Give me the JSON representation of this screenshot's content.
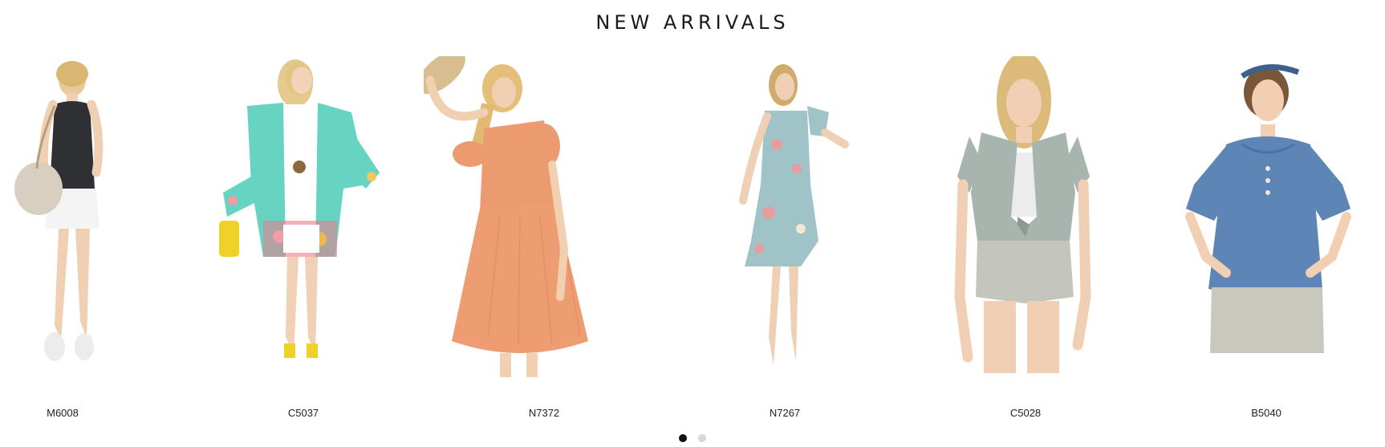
{
  "section": {
    "title": "NEW ARRIVALS"
  },
  "products": [
    {
      "code": "M6008",
      "image_alt": "Woman in black ribbed tank top with white denim mini skirt and white sneakers, carrying a woven bag"
    },
    {
      "code": "C5037",
      "image_alt": "Woman in aqua floral-print kimono over white top and white shorts with yellow sandals and yellow handbag"
    },
    {
      "code": "N7372",
      "image_alt": "Woman in peach puff-sleeve button-front dress holding a straw hat"
    },
    {
      "code": "N7267",
      "image_alt": "Woman in light blue floral flutter-sleeve midi dress with strappy heels"
    },
    {
      "code": "C5028",
      "image_alt": "Woman in sage floral tie-front cardigan over white tank with grey denim shorts"
    },
    {
      "code": "B5040",
      "image_alt": "Woman in blue ribbed flutter-sleeve henley top with grey shorts and a headband"
    }
  ],
  "carousel": {
    "pages": 2,
    "current_page": 1
  },
  "colors": {
    "active_dot": "#111111",
    "inactive_dot": "#d8d8d8"
  }
}
